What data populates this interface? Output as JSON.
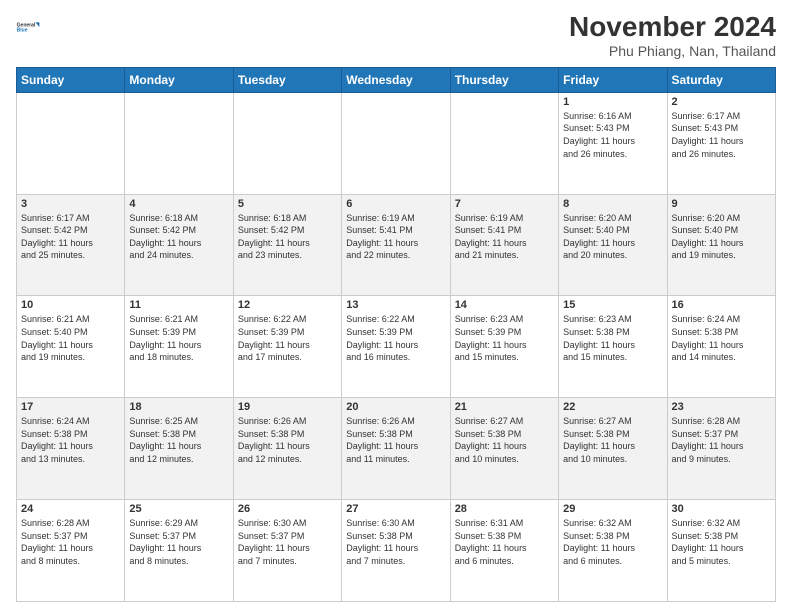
{
  "logo": {
    "line1": "General",
    "line2": "Blue"
  },
  "title": "November 2024",
  "subtitle": "Phu Phiang, Nan, Thailand",
  "days_of_week": [
    "Sunday",
    "Monday",
    "Tuesday",
    "Wednesday",
    "Thursday",
    "Friday",
    "Saturday"
  ],
  "weeks": [
    [
      {
        "day": "",
        "info": ""
      },
      {
        "day": "",
        "info": ""
      },
      {
        "day": "",
        "info": ""
      },
      {
        "day": "",
        "info": ""
      },
      {
        "day": "",
        "info": ""
      },
      {
        "day": "1",
        "info": "Sunrise: 6:16 AM\nSunset: 5:43 PM\nDaylight: 11 hours\nand 26 minutes."
      },
      {
        "day": "2",
        "info": "Sunrise: 6:17 AM\nSunset: 5:43 PM\nDaylight: 11 hours\nand 26 minutes."
      }
    ],
    [
      {
        "day": "3",
        "info": "Sunrise: 6:17 AM\nSunset: 5:42 PM\nDaylight: 11 hours\nand 25 minutes."
      },
      {
        "day": "4",
        "info": "Sunrise: 6:18 AM\nSunset: 5:42 PM\nDaylight: 11 hours\nand 24 minutes."
      },
      {
        "day": "5",
        "info": "Sunrise: 6:18 AM\nSunset: 5:42 PM\nDaylight: 11 hours\nand 23 minutes."
      },
      {
        "day": "6",
        "info": "Sunrise: 6:19 AM\nSunset: 5:41 PM\nDaylight: 11 hours\nand 22 minutes."
      },
      {
        "day": "7",
        "info": "Sunrise: 6:19 AM\nSunset: 5:41 PM\nDaylight: 11 hours\nand 21 minutes."
      },
      {
        "day": "8",
        "info": "Sunrise: 6:20 AM\nSunset: 5:40 PM\nDaylight: 11 hours\nand 20 minutes."
      },
      {
        "day": "9",
        "info": "Sunrise: 6:20 AM\nSunset: 5:40 PM\nDaylight: 11 hours\nand 19 minutes."
      }
    ],
    [
      {
        "day": "10",
        "info": "Sunrise: 6:21 AM\nSunset: 5:40 PM\nDaylight: 11 hours\nand 19 minutes."
      },
      {
        "day": "11",
        "info": "Sunrise: 6:21 AM\nSunset: 5:39 PM\nDaylight: 11 hours\nand 18 minutes."
      },
      {
        "day": "12",
        "info": "Sunrise: 6:22 AM\nSunset: 5:39 PM\nDaylight: 11 hours\nand 17 minutes."
      },
      {
        "day": "13",
        "info": "Sunrise: 6:22 AM\nSunset: 5:39 PM\nDaylight: 11 hours\nand 16 minutes."
      },
      {
        "day": "14",
        "info": "Sunrise: 6:23 AM\nSunset: 5:39 PM\nDaylight: 11 hours\nand 15 minutes."
      },
      {
        "day": "15",
        "info": "Sunrise: 6:23 AM\nSunset: 5:38 PM\nDaylight: 11 hours\nand 15 minutes."
      },
      {
        "day": "16",
        "info": "Sunrise: 6:24 AM\nSunset: 5:38 PM\nDaylight: 11 hours\nand 14 minutes."
      }
    ],
    [
      {
        "day": "17",
        "info": "Sunrise: 6:24 AM\nSunset: 5:38 PM\nDaylight: 11 hours\nand 13 minutes."
      },
      {
        "day": "18",
        "info": "Sunrise: 6:25 AM\nSunset: 5:38 PM\nDaylight: 11 hours\nand 12 minutes."
      },
      {
        "day": "19",
        "info": "Sunrise: 6:26 AM\nSunset: 5:38 PM\nDaylight: 11 hours\nand 12 minutes."
      },
      {
        "day": "20",
        "info": "Sunrise: 6:26 AM\nSunset: 5:38 PM\nDaylight: 11 hours\nand 11 minutes."
      },
      {
        "day": "21",
        "info": "Sunrise: 6:27 AM\nSunset: 5:38 PM\nDaylight: 11 hours\nand 10 minutes."
      },
      {
        "day": "22",
        "info": "Sunrise: 6:27 AM\nSunset: 5:38 PM\nDaylight: 11 hours\nand 10 minutes."
      },
      {
        "day": "23",
        "info": "Sunrise: 6:28 AM\nSunset: 5:37 PM\nDaylight: 11 hours\nand 9 minutes."
      }
    ],
    [
      {
        "day": "24",
        "info": "Sunrise: 6:28 AM\nSunset: 5:37 PM\nDaylight: 11 hours\nand 8 minutes."
      },
      {
        "day": "25",
        "info": "Sunrise: 6:29 AM\nSunset: 5:37 PM\nDaylight: 11 hours\nand 8 minutes."
      },
      {
        "day": "26",
        "info": "Sunrise: 6:30 AM\nSunset: 5:37 PM\nDaylight: 11 hours\nand 7 minutes."
      },
      {
        "day": "27",
        "info": "Sunrise: 6:30 AM\nSunset: 5:38 PM\nDaylight: 11 hours\nand 7 minutes."
      },
      {
        "day": "28",
        "info": "Sunrise: 6:31 AM\nSunset: 5:38 PM\nDaylight: 11 hours\nand 6 minutes."
      },
      {
        "day": "29",
        "info": "Sunrise: 6:32 AM\nSunset: 5:38 PM\nDaylight: 11 hours\nand 6 minutes."
      },
      {
        "day": "30",
        "info": "Sunrise: 6:32 AM\nSunset: 5:38 PM\nDaylight: 11 hours\nand 5 minutes."
      }
    ]
  ]
}
